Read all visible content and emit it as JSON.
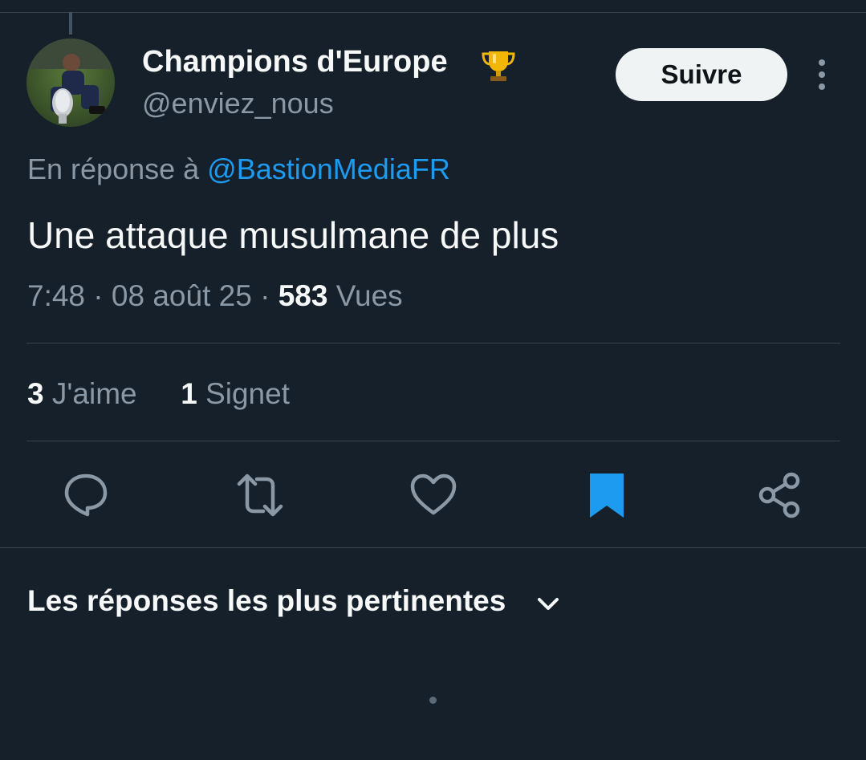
{
  "tweet": {
    "display_name": "Champions d'Europe",
    "handle": "@enviez_nous",
    "follow_label": "Suivre",
    "reply_prefix": "En réponse à",
    "reply_mention": "@BastionMediaFR",
    "text": "Une attaque musulmane de plus",
    "time": "7:48",
    "date": "08 août 25",
    "views_count": "583",
    "views_label": "Vues",
    "separator": "·"
  },
  "stats": {
    "likes_count": "3",
    "likes_label": "J'aime",
    "bookmarks_count": "1",
    "bookmarks_label": "Signet"
  },
  "actions": [
    {
      "icon": "reply-icon"
    },
    {
      "icon": "retweet-icon"
    },
    {
      "icon": "like-icon"
    },
    {
      "icon": "bookmark-icon",
      "active": true
    },
    {
      "icon": "share-icon"
    }
  ],
  "replies": {
    "sort_label": "Les réponses les plus pertinentes"
  },
  "colors": {
    "background": "#15202b",
    "accent": "#1d9bf0",
    "muted": "#8b98a5",
    "text": "#f7f9f9",
    "border": "#38444d"
  }
}
